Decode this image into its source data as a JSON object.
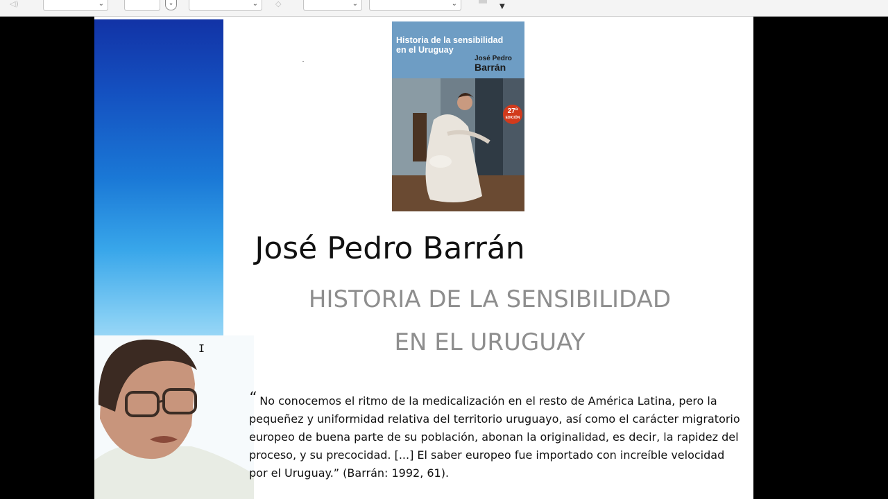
{
  "toolbar": {
    "controls": [
      {
        "name": "font-size-select",
        "value": ""
      },
      {
        "name": "page-number-field",
        "value": ""
      },
      {
        "name": "zoom-select",
        "value": ""
      },
      {
        "name": "style-select",
        "value": ""
      },
      {
        "name": "format-select",
        "value": ""
      }
    ],
    "icons": [
      "speaker-icon",
      "dropdown-round-icon",
      "pencil-icon",
      "overflow-arrow-icon"
    ]
  },
  "slide": {
    "book_cover": {
      "title_line1": "Historia de la sensibilidad",
      "title_line2": "en el Uruguay",
      "author_first": "José Pedro",
      "author_last": "Barrán",
      "edition_number": "27ª",
      "edition_label": "EDICIÓN"
    },
    "author": "José Pedro Barrán",
    "subtitle_line1": "HISTORIA DE LA SENSIBILIDAD",
    "subtitle_line2": "EN EL URUGUAY",
    "quote_mark": "“",
    "quote": "No conocemos el ritmo de la medicalización en el resto de América Latina, pero la pequeñez y uniformidad relativa del territorio uruguayo, así como el carácter migratorio europeo de buena parte de su población, abonan la originalidad, es decir, la rapidez del proceso, y su precocidad. [...] El saber europeo fue importado con increíble velocidad por el Uruguay.” (Barrán: 1992, 61)."
  },
  "colors": {
    "band_top": "#1233a6",
    "band_mid": "#38a6ea",
    "subtitle_gray": "#8e8e8e",
    "book_top_blue": "#6e9dc4",
    "badge_red": "#d23a1c"
  }
}
